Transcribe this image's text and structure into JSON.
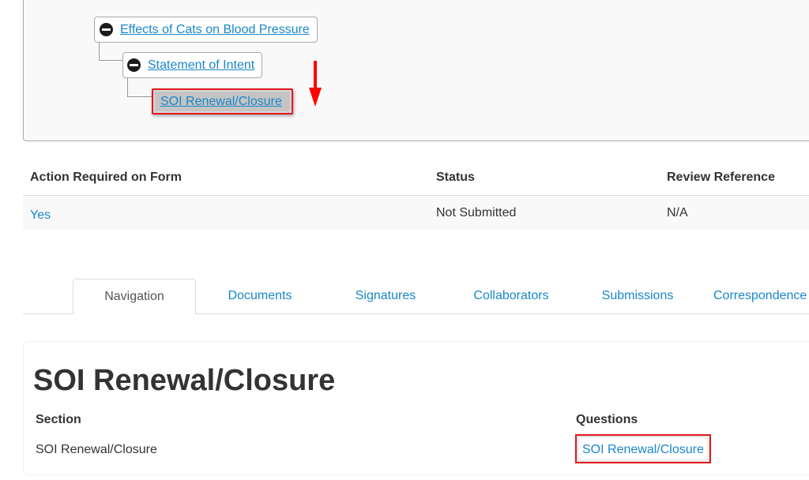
{
  "tree": {
    "nodes": [
      {
        "label": "Effects of Cats on Blood Pressure",
        "icon": "minus-circle-icon",
        "expanded": true
      },
      {
        "label": "Statement of Intent",
        "icon": "minus-circle-icon",
        "expanded": true
      },
      {
        "label": "SOI Renewal/Closure",
        "selected": true,
        "highlighted": true
      }
    ],
    "annotation": {
      "type": "arrow-down",
      "color": "#ff0000"
    }
  },
  "status_table": {
    "headers": [
      "Action Required on Form",
      "Status",
      "Review Reference"
    ],
    "rows": [
      {
        "action_required": "Yes",
        "status": "Not Submitted",
        "review_reference": "N/A"
      }
    ]
  },
  "tabs": [
    {
      "label": "Navigation",
      "active": true
    },
    {
      "label": "Documents",
      "active": false
    },
    {
      "label": "Signatures",
      "active": false
    },
    {
      "label": "Collaborators",
      "active": false
    },
    {
      "label": "Submissions",
      "active": false
    },
    {
      "label": "Correspondence",
      "active": false
    }
  ],
  "content": {
    "title": "SOI Renewal/Closure",
    "columns": [
      "Section",
      "Questions"
    ],
    "rows": [
      {
        "section": "SOI Renewal/Closure",
        "questions": "SOI Renewal/Closure",
        "questions_highlighted": true
      }
    ]
  },
  "colors": {
    "link": "#1a87c9",
    "highlight": "#e0181e",
    "annotation_arrow": "#ff0000"
  }
}
